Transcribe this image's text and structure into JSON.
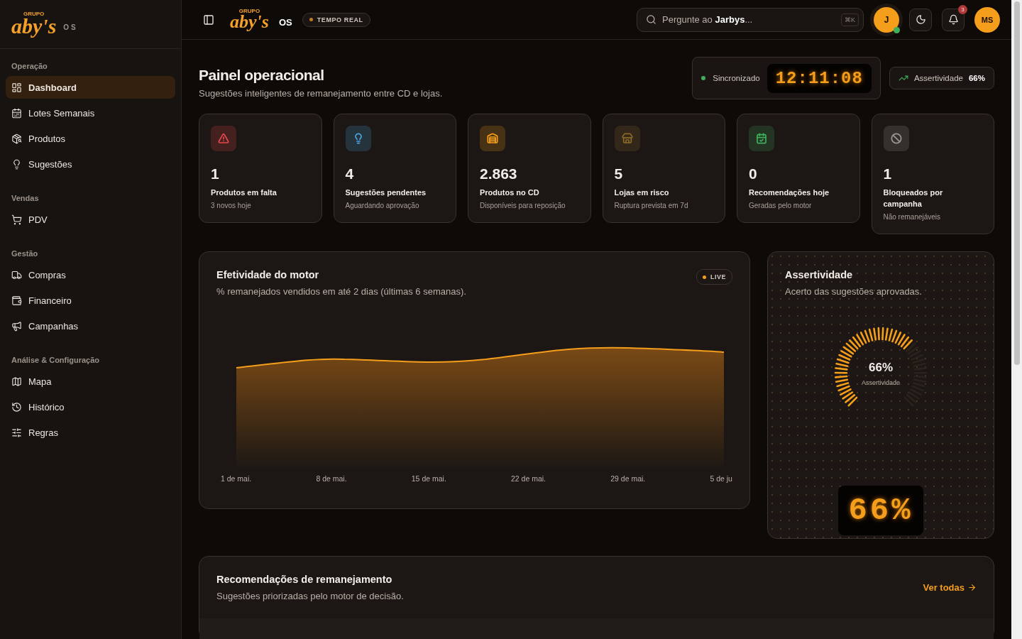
{
  "sidebar_brand": {
    "small": "GRUPO",
    "logo": "aby's",
    "suffix": "OS"
  },
  "topbar_brand": {
    "small": "GRUPO",
    "logo": "aby's",
    "suffix": "OS"
  },
  "sidebar": {
    "sections": [
      {
        "title": "Operação",
        "items": [
          {
            "label": "Dashboard",
            "selected": true
          },
          {
            "label": "Lotes Semanais",
            "selected": false
          },
          {
            "label": "Produtos",
            "selected": false
          },
          {
            "label": "Sugestões",
            "selected": false
          }
        ]
      },
      {
        "title": "Vendas",
        "items": [
          {
            "label": "PDV",
            "selected": false
          }
        ]
      },
      {
        "title": "Gestão",
        "items": [
          {
            "label": "Compras",
            "selected": false
          },
          {
            "label": "Financeiro",
            "selected": false
          },
          {
            "label": "Campanhas",
            "selected": false
          }
        ]
      },
      {
        "title": "Análise & Configuração",
        "items": [
          {
            "label": "Mapa",
            "selected": false
          },
          {
            "label": "Histórico",
            "selected": false
          },
          {
            "label": "Regras",
            "selected": false
          }
        ]
      }
    ]
  },
  "topbar": {
    "badge": "TEMPO REAL",
    "search": {
      "placeholder_start": "Pergunte ao ",
      "placeholder_bold": "Jarbys",
      "placeholder_end": "...",
      "shortcut": "⌘K"
    },
    "assistant": "J",
    "notifications": "3",
    "user": "MS"
  },
  "header": {
    "title": "Painel operacional",
    "subtitle": "Sugestões inteligentes de remanejamento entre CD e lojas.",
    "sync": "Sincronizado",
    "clock": "12:11:08",
    "accuracy_label": "Assertividade",
    "accuracy_value": "66%"
  },
  "stats": [
    {
      "value": "1",
      "label": "Produtos em falta",
      "note": "3 novos hoje",
      "color": "#e5484d"
    },
    {
      "value": "4",
      "label": "Sugestões pendentes",
      "note": "Aguardando aprovação",
      "color": "#4aa3e0"
    },
    {
      "value": "2.863",
      "label": "Produtos no CD",
      "note": "Disponíveis para reposição",
      "color": "#f59e1b"
    },
    {
      "value": "5",
      "label": "Lojas em risco",
      "note": "Ruptura prevista em 7d",
      "color": "#8a6a2a"
    },
    {
      "value": "0",
      "label": "Recomendações hoje",
      "note": "Geradas pelo motor",
      "color": "#3fae5a"
    },
    {
      "value": "1",
      "label": "Bloqueados por campanha",
      "note": "Não remanejáveis",
      "color": "#9a9590"
    }
  ],
  "effectiveness": {
    "title": "Efetividade do motor",
    "subtitle": "% remanejados vendidos em até 2 dias (últimas 6 semanas).",
    "badge": "LIVE",
    "x_labels": [
      "1 de mai.",
      "8 de mai.",
      "15 de mai.",
      "22 de mai.",
      "29 de mai.",
      "5 de ju"
    ]
  },
  "accuracy": {
    "title": "Assertividade",
    "subtitle": "Acerto das sugestões aprovadas.",
    "value": "66%",
    "caption": "Assertividade",
    "level": 0.66,
    "display": "66%"
  },
  "recommendations": {
    "title": "Recomendações de remanejamento",
    "subtitle": "Sugestões priorizadas pelo motor de decisão.",
    "link": "Ver todas"
  }
}
